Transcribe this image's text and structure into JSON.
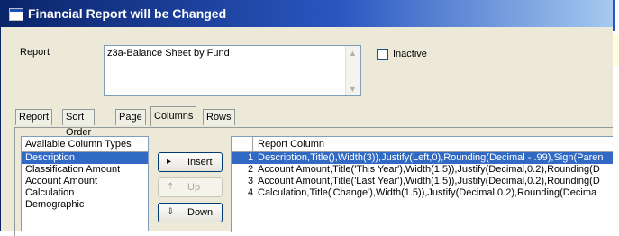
{
  "window": {
    "title": "Financial Report will be Changed"
  },
  "report": {
    "label": "Report",
    "value": "z3a-Balance Sheet by Fund",
    "inactive_label": "Inactive",
    "inactive_checked": false
  },
  "tabs": [
    {
      "label": "Report",
      "active": false
    },
    {
      "label": "Sort Order",
      "active": false
    },
    {
      "label": "Page",
      "active": false
    },
    {
      "label": "Columns",
      "active": true
    },
    {
      "label": "Rows",
      "active": false
    }
  ],
  "available_columns": {
    "header": "Available Column Types",
    "items": [
      "Description",
      "Classification Amount",
      "Account Amount",
      "Calculation",
      "Demographic"
    ],
    "selected_index": 0
  },
  "buttons": {
    "insert": {
      "label": "Insert",
      "icon": "play-right-icon",
      "enabled": true
    },
    "up": {
      "label": "Up",
      "icon": "arrow-up-icon",
      "enabled": false
    },
    "down": {
      "label": "Down",
      "icon": "arrow-down-icon",
      "enabled": true
    }
  },
  "report_columns": {
    "header": "Report Column",
    "rows": [
      {
        "num": "1",
        "text": "Description,Title(),Width(3)),Justify(Left,0),Rounding(Decimal - .99),Sign(Paren"
      },
      {
        "num": "2",
        "text": "Account Amount,Title('This Year'),Width(1.5)),Justify(Decimal,0.2),Rounding(D"
      },
      {
        "num": "3",
        "text": "Account Amount,Title('Last Year'),Width(1.5)),Justify(Decimal,0.2),Rounding(D"
      },
      {
        "num": "4",
        "text": "Calculation,Title('Change'),Width(1.5)),Justify(Decimal,0.2),Rounding(Decima"
      }
    ],
    "selected_index": 0
  },
  "colors": {
    "selection": "#316ac5",
    "titlebar": "#0a246a",
    "dialog_bg": "#ece9d8"
  }
}
